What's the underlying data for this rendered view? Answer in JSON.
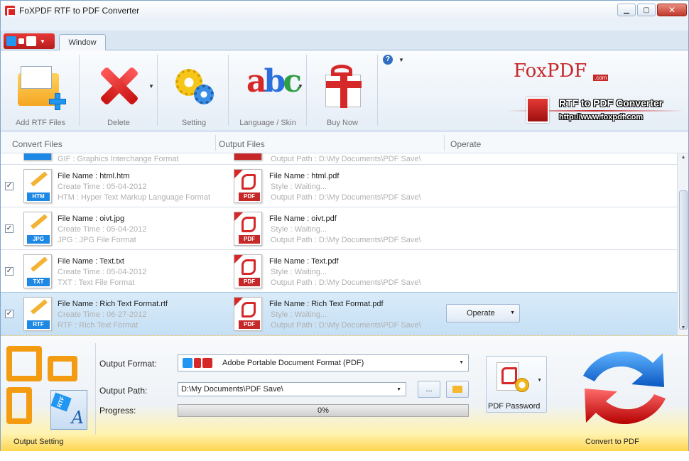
{
  "window": {
    "title": "FoXPDF RTF to PDF Converter",
    "minimize": "▁",
    "maximize": "▢",
    "close": "✕"
  },
  "tabs": {
    "active": "Window"
  },
  "ribbon": {
    "add_label": "Add RTF Files",
    "delete_label": "Delete",
    "setting_label": "Setting",
    "language_label": "Language / Skin",
    "buy_label": "Buy Now",
    "help": "?"
  },
  "logo": {
    "brand": "FoxPDF",
    "com": ".com",
    "product": "RTF to PDF Converter",
    "url": "http://www.foxpdf.com"
  },
  "list": {
    "columns": [
      "Convert Files",
      "Output Files",
      "Operate"
    ],
    "partial_row": {
      "src_desc": "GIF : Graphics Interchange Format",
      "out_path": "Output Path : D:\\My Documents\\PDF Save\\"
    },
    "rows": [
      {
        "checked": "✓",
        "src_tag": "HTM",
        "src_name": "File Name : html.htm",
        "src_time": "Create Time : 05-04-2012",
        "src_desc": "HTM : Hyper Text Markup Language Format",
        "pdf_tag": "PDF",
        "out_name": "File Name : html.pdf",
        "out_style": "Style : Waiting...",
        "out_path": "Output Path : D:\\My Documents\\PDF Save\\"
      },
      {
        "checked": "✓",
        "src_tag": "JPG",
        "src_name": "File Name : oivt.jpg",
        "src_time": "Create Time : 05-04-2012",
        "src_desc": "JPG : JPG File Format",
        "pdf_tag": "PDF",
        "out_name": "File Name : oivt.pdf",
        "out_style": "Style : Waiting...",
        "out_path": "Output Path : D:\\My Documents\\PDF Save\\"
      },
      {
        "checked": "✓",
        "src_tag": "TXT",
        "src_name": "File Name : Text.txt",
        "src_time": "Create Time : 05-04-2012",
        "src_desc": "TXT : Text File Format",
        "pdf_tag": "PDF",
        "out_name": "File Name : Text.pdf",
        "out_style": "Style : Waiting...",
        "out_path": "Output Path : D:\\My Documents\\PDF Save\\"
      },
      {
        "checked": "✓",
        "src_tag": "RTF",
        "src_name": "File Name : Rich Text Format.rtf",
        "src_time": "Create Time : 06-27-2012",
        "src_desc": "RTF : Rich Text Format",
        "pdf_tag": "PDF",
        "out_name": "File Name : Rich Text Format.pdf",
        "out_style": "Style : Waiting...",
        "out_path": "Output Path : D:\\My Documents\\PDF Save\\",
        "operate": "Operate"
      }
    ]
  },
  "output": {
    "format_label": "Output Format:",
    "format_value": "Adobe Portable Document Format (PDF)",
    "path_label": "Output Path:",
    "path_value": "D:\\My Documents\\PDF Save\\",
    "browse": "...",
    "progress_label": "Progress:",
    "progress_value": "0%",
    "progress_fraction": 0,
    "password_label": "PDF Password",
    "section_label": "Output Setting",
    "convert_label": "Convert to PDF"
  },
  "icons": {
    "rtf_chip": "RTF",
    "rtf_doc": "RTF",
    "big_a": "A"
  },
  "colors": {
    "accent_red": "#d62828",
    "accent_blue": "#1e88e5",
    "selected_row": "#c6e0f5"
  }
}
